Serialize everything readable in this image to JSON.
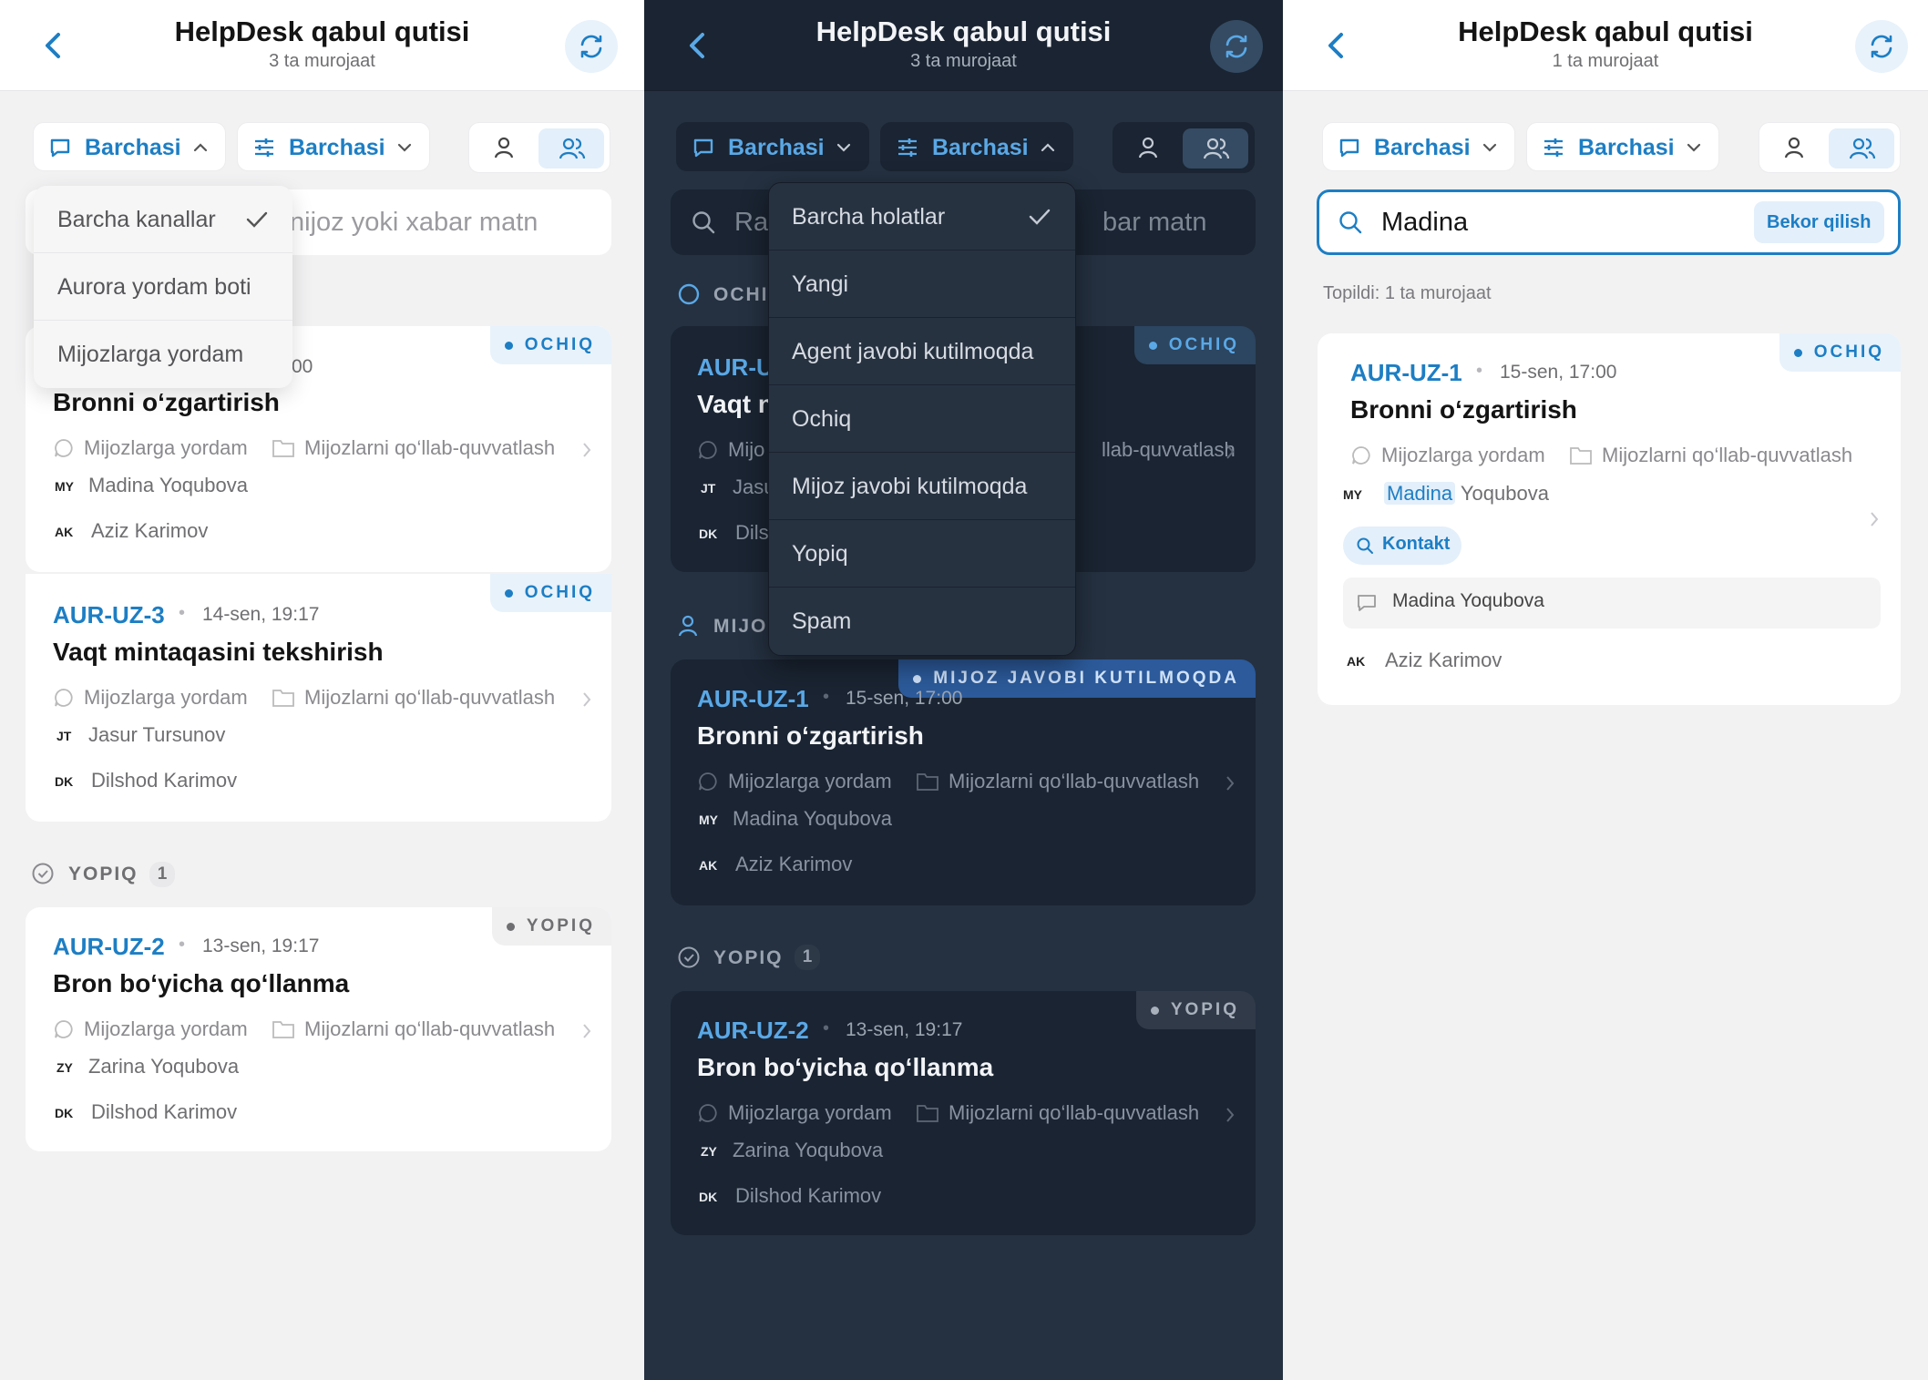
{
  "colors": {
    "accent": "#1d7ec4",
    "dark_bg": "#253141",
    "light_bg": "#f2f2f3"
  },
  "panels": [
    {
      "title": "HelpDesk qabul qutisi",
      "subtitle": "3 ta murojaat",
      "channel_filter": "Barchasi",
      "status_filter": "Barchasi",
      "search_placeholder_visible": "nijoz yoki xabar matn",
      "channel_menu": {
        "items": [
          "Barcha kanallar",
          "Aurora yordam boti",
          "Mijozlarga yordam"
        ],
        "selected": "Barcha kanallar"
      },
      "partial_date": "00",
      "open_cards": [
        {
          "id": "",
          "date": "",
          "title": "Bronni o‘zgartirish",
          "badge": "OCHIQ",
          "channel": "Mijozlarga yordam",
          "team": "Mijozlarni qo‘llab-quvvatlash",
          "contact_initials": "MY",
          "contact": "Madina Yoqubova",
          "agent_initials": "AK",
          "agent": "Aziz Karimov"
        },
        {
          "id": "AUR-UZ-3",
          "date": "14-sen, 19:17",
          "title": "Vaqt mintaqasini tekshirish",
          "badge": "OCHIQ",
          "channel": "Mijozlarga yordam",
          "team": "Mijozlarni qo‘llab-quvvatlash",
          "contact_initials": "JT",
          "contact": "Jasur Tursunov",
          "agent_initials": "DK",
          "agent": "Dilshod Karimov"
        }
      ],
      "closed_section": {
        "label": "YOPIQ",
        "count": "1"
      },
      "closed_card": {
        "id": "AUR-UZ-2",
        "date": "13-sen, 19:17",
        "title": "Bron bo‘yicha qo‘llanma",
        "badge": "YOPIQ",
        "channel": "Mijozlarga yordam",
        "team": "Mijozlarni qo‘llab-quvvatlash",
        "contact_initials": "ZY",
        "contact": "Zarina Yoqubova",
        "agent_initials": "DK",
        "agent": "Dilshod Karimov"
      }
    },
    {
      "title": "HelpDesk qabul qutisi",
      "subtitle": "3 ta murojaat",
      "channel_filter": "Barchasi",
      "status_filter": "Barchasi",
      "search_left_visible": "Ra",
      "search_right_visible": "bar matn",
      "status_menu": {
        "items": [
          "Barcha holatlar",
          "Yangi",
          "Agent javobi kutilmoqda",
          "Ochiq",
          "Mijoz javobi kutilmoqda",
          "Yopiq",
          "Spam"
        ],
        "selected": "Barcha holatlar"
      },
      "open_section_visible": "OCHI",
      "open_card_partial": {
        "id": "AUR-U",
        "title": "Vaqt n",
        "channel": "Mijo",
        "team": "llab-quvvatlash",
        "contact_initials": "JT",
        "contact": "Jasu",
        "agent_initials": "DK",
        "agent": "Dils",
        "badge": "OCHIQ"
      },
      "waiting_section_visible": "MIJO",
      "waiting_card": {
        "id": "AUR-UZ-1",
        "date": "15-sen, 17:00",
        "title": "Bronni o‘zgartirish",
        "badge": "MIJOZ JAVOBI KUTILMOQDA",
        "channel": "Mijozlarga yordam",
        "team": "Mijozlarni qo‘llab-quvvatlash",
        "contact_initials": "MY",
        "contact": "Madina Yoqubova",
        "agent_initials": "AK",
        "agent": "Aziz Karimov"
      },
      "closed_section": {
        "label": "YOPIQ",
        "count": "1"
      },
      "closed_card": {
        "id": "AUR-UZ-2",
        "date": "13-sen, 19:17",
        "title": "Bron bo‘yicha qo‘llanma",
        "badge": "YOPIQ",
        "channel": "Mijozlarga yordam",
        "team": "Mijozlarni qo‘llab-quvvatlash",
        "contact_initials": "ZY",
        "contact": "Zarina Yoqubova",
        "agent_initials": "DK",
        "agent": "Dilshod Karimov"
      }
    },
    {
      "title": "HelpDesk qabul qutisi",
      "subtitle": "1 ta murojaat",
      "channel_filter": "Barchasi",
      "status_filter": "Barchasi",
      "search_value": "Madina",
      "cancel_label": "Bekor qilish",
      "result_text": "Topildi: 1 ta murojaat",
      "card": {
        "id": "AUR-UZ-1",
        "date": "15-sen, 17:00",
        "title": "Bronni o‘zgartirish",
        "badge": "OCHIQ",
        "channel": "Mijozlarga yordam",
        "team": "Mijozlarni qo‘llab-quvvatlash",
        "contact_initials": "MY",
        "contact_match": "Madina",
        "contact_rest": " Yoqubova",
        "match_tag": "Kontakt",
        "match_snippet": "Madina Yoqubova",
        "agent_initials": "AK",
        "agent": "Aziz Karimov"
      }
    }
  ]
}
